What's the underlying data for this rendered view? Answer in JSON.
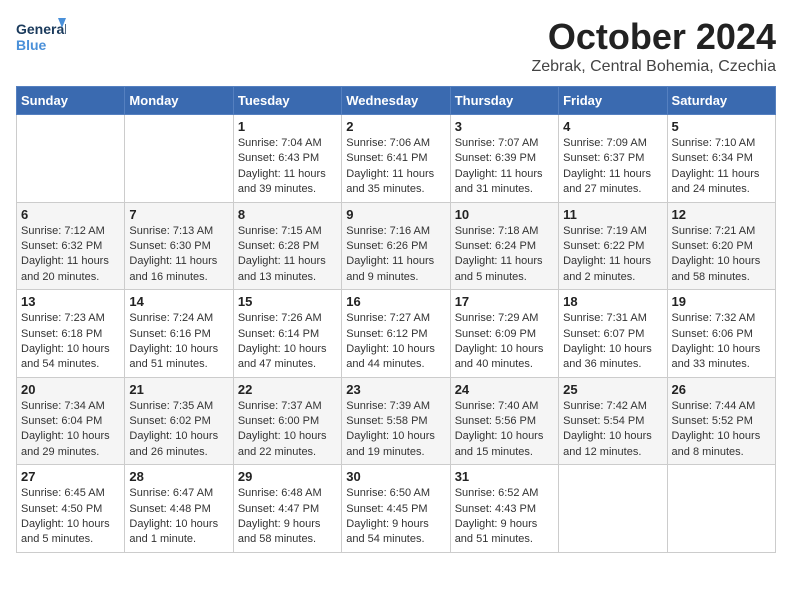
{
  "header": {
    "logo_general": "General",
    "logo_blue": "Blue",
    "month_title": "October 2024",
    "location": "Zebrak, Central Bohemia, Czechia"
  },
  "days_of_week": [
    "Sunday",
    "Monday",
    "Tuesday",
    "Wednesday",
    "Thursday",
    "Friday",
    "Saturday"
  ],
  "weeks": [
    [
      {
        "day": "",
        "content": ""
      },
      {
        "day": "",
        "content": ""
      },
      {
        "day": "1",
        "content": "Sunrise: 7:04 AM\nSunset: 6:43 PM\nDaylight: 11 hours and 39 minutes."
      },
      {
        "day": "2",
        "content": "Sunrise: 7:06 AM\nSunset: 6:41 PM\nDaylight: 11 hours and 35 minutes."
      },
      {
        "day": "3",
        "content": "Sunrise: 7:07 AM\nSunset: 6:39 PM\nDaylight: 11 hours and 31 minutes."
      },
      {
        "day": "4",
        "content": "Sunrise: 7:09 AM\nSunset: 6:37 PM\nDaylight: 11 hours and 27 minutes."
      },
      {
        "day": "5",
        "content": "Sunrise: 7:10 AM\nSunset: 6:34 PM\nDaylight: 11 hours and 24 minutes."
      }
    ],
    [
      {
        "day": "6",
        "content": "Sunrise: 7:12 AM\nSunset: 6:32 PM\nDaylight: 11 hours and 20 minutes."
      },
      {
        "day": "7",
        "content": "Sunrise: 7:13 AM\nSunset: 6:30 PM\nDaylight: 11 hours and 16 minutes."
      },
      {
        "day": "8",
        "content": "Sunrise: 7:15 AM\nSunset: 6:28 PM\nDaylight: 11 hours and 13 minutes."
      },
      {
        "day": "9",
        "content": "Sunrise: 7:16 AM\nSunset: 6:26 PM\nDaylight: 11 hours and 9 minutes."
      },
      {
        "day": "10",
        "content": "Sunrise: 7:18 AM\nSunset: 6:24 PM\nDaylight: 11 hours and 5 minutes."
      },
      {
        "day": "11",
        "content": "Sunrise: 7:19 AM\nSunset: 6:22 PM\nDaylight: 11 hours and 2 minutes."
      },
      {
        "day": "12",
        "content": "Sunrise: 7:21 AM\nSunset: 6:20 PM\nDaylight: 10 hours and 58 minutes."
      }
    ],
    [
      {
        "day": "13",
        "content": "Sunrise: 7:23 AM\nSunset: 6:18 PM\nDaylight: 10 hours and 54 minutes."
      },
      {
        "day": "14",
        "content": "Sunrise: 7:24 AM\nSunset: 6:16 PM\nDaylight: 10 hours and 51 minutes."
      },
      {
        "day": "15",
        "content": "Sunrise: 7:26 AM\nSunset: 6:14 PM\nDaylight: 10 hours and 47 minutes."
      },
      {
        "day": "16",
        "content": "Sunrise: 7:27 AM\nSunset: 6:12 PM\nDaylight: 10 hours and 44 minutes."
      },
      {
        "day": "17",
        "content": "Sunrise: 7:29 AM\nSunset: 6:09 PM\nDaylight: 10 hours and 40 minutes."
      },
      {
        "day": "18",
        "content": "Sunrise: 7:31 AM\nSunset: 6:07 PM\nDaylight: 10 hours and 36 minutes."
      },
      {
        "day": "19",
        "content": "Sunrise: 7:32 AM\nSunset: 6:06 PM\nDaylight: 10 hours and 33 minutes."
      }
    ],
    [
      {
        "day": "20",
        "content": "Sunrise: 7:34 AM\nSunset: 6:04 PM\nDaylight: 10 hours and 29 minutes."
      },
      {
        "day": "21",
        "content": "Sunrise: 7:35 AM\nSunset: 6:02 PM\nDaylight: 10 hours and 26 minutes."
      },
      {
        "day": "22",
        "content": "Sunrise: 7:37 AM\nSunset: 6:00 PM\nDaylight: 10 hours and 22 minutes."
      },
      {
        "day": "23",
        "content": "Sunrise: 7:39 AM\nSunset: 5:58 PM\nDaylight: 10 hours and 19 minutes."
      },
      {
        "day": "24",
        "content": "Sunrise: 7:40 AM\nSunset: 5:56 PM\nDaylight: 10 hours and 15 minutes."
      },
      {
        "day": "25",
        "content": "Sunrise: 7:42 AM\nSunset: 5:54 PM\nDaylight: 10 hours and 12 minutes."
      },
      {
        "day": "26",
        "content": "Sunrise: 7:44 AM\nSunset: 5:52 PM\nDaylight: 10 hours and 8 minutes."
      }
    ],
    [
      {
        "day": "27",
        "content": "Sunrise: 6:45 AM\nSunset: 4:50 PM\nDaylight: 10 hours and 5 minutes."
      },
      {
        "day": "28",
        "content": "Sunrise: 6:47 AM\nSunset: 4:48 PM\nDaylight: 10 hours and 1 minute."
      },
      {
        "day": "29",
        "content": "Sunrise: 6:48 AM\nSunset: 4:47 PM\nDaylight: 9 hours and 58 minutes."
      },
      {
        "day": "30",
        "content": "Sunrise: 6:50 AM\nSunset: 4:45 PM\nDaylight: 9 hours and 54 minutes."
      },
      {
        "day": "31",
        "content": "Sunrise: 6:52 AM\nSunset: 4:43 PM\nDaylight: 9 hours and 51 minutes."
      },
      {
        "day": "",
        "content": ""
      },
      {
        "day": "",
        "content": ""
      }
    ]
  ]
}
